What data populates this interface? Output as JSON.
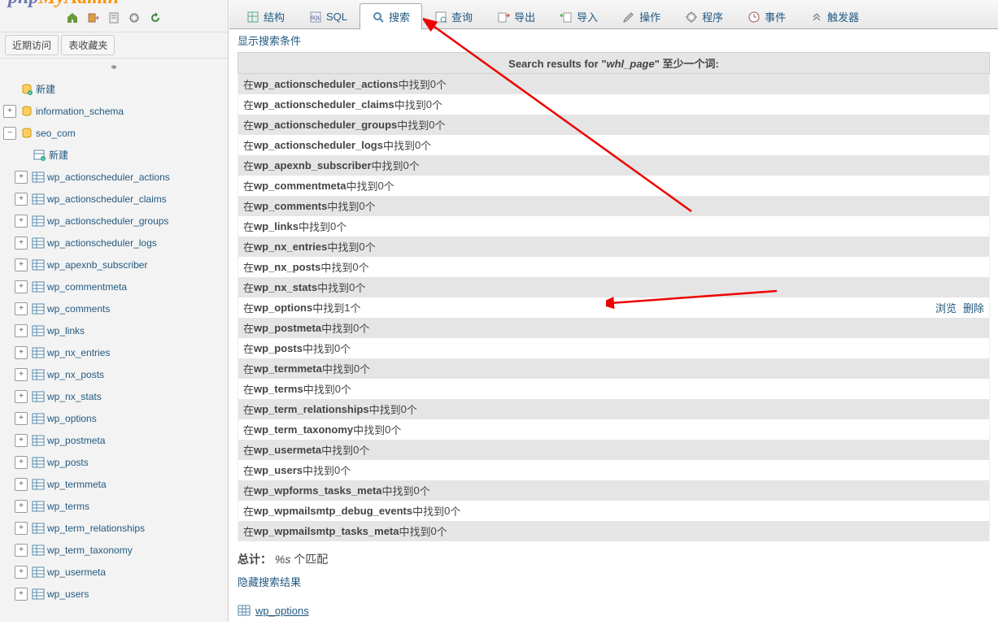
{
  "logo_fragment": "phpMyAdmin",
  "toolbar_icons": [
    "home-icon",
    "logout-icon",
    "docs-icon",
    "settings-icon",
    "reload-icon"
  ],
  "recent": {
    "recent_label": "近期访问",
    "favorites_label": "表收藏夹"
  },
  "sidebar": {
    "new_label": "新建",
    "dbs": [
      {
        "name": "information_schema",
        "expanded": false
      },
      {
        "name": "seo_com",
        "expanded": true,
        "new_label": "新建",
        "tables": [
          "wp_actionscheduler_actions",
          "wp_actionscheduler_claims",
          "wp_actionscheduler_groups",
          "wp_actionscheduler_logs",
          "wp_apexnb_subscriber",
          "wp_commentmeta",
          "wp_comments",
          "wp_links",
          "wp_nx_entries",
          "wp_nx_posts",
          "wp_nx_stats",
          "wp_options",
          "wp_postmeta",
          "wp_posts",
          "wp_termmeta",
          "wp_terms",
          "wp_term_relationships",
          "wp_term_taxonomy",
          "wp_usermeta",
          "wp_users"
        ]
      }
    ]
  },
  "tabs": [
    {
      "key": "structure",
      "label": "结构"
    },
    {
      "key": "sql",
      "label": "SQL"
    },
    {
      "key": "search",
      "label": "搜索",
      "active": true
    },
    {
      "key": "query",
      "label": "查询"
    },
    {
      "key": "export",
      "label": "导出"
    },
    {
      "key": "import",
      "label": "导入"
    },
    {
      "key": "operations",
      "label": "操作"
    },
    {
      "key": "routines",
      "label": "程序"
    },
    {
      "key": "events",
      "label": "事件"
    },
    {
      "key": "triggers",
      "label": "触发器"
    }
  ],
  "search": {
    "show_criteria": "显示搜索条件",
    "heading_prefix": "Search results for \"",
    "heading_term": "whl_page",
    "heading_suffix": "\" 至少一个词:",
    "row_prefix": "在 ",
    "row_mid": " 中找到 ",
    "row_suffix": " 个",
    "results": [
      {
        "table": "wp_actionscheduler_actions",
        "count": 0
      },
      {
        "table": "wp_actionscheduler_claims",
        "count": 0
      },
      {
        "table": "wp_actionscheduler_groups",
        "count": 0
      },
      {
        "table": "wp_actionscheduler_logs",
        "count": 0
      },
      {
        "table": "wp_apexnb_subscriber",
        "count": 0
      },
      {
        "table": "wp_commentmeta",
        "count": 0
      },
      {
        "table": "wp_comments",
        "count": 0
      },
      {
        "table": "wp_links",
        "count": 0
      },
      {
        "table": "wp_nx_entries",
        "count": 0
      },
      {
        "table": "wp_nx_posts",
        "count": 0
      },
      {
        "table": "wp_nx_stats",
        "count": 0
      },
      {
        "table": "wp_options",
        "count": 1,
        "browse": "浏览",
        "delete": "删除"
      },
      {
        "table": "wp_postmeta",
        "count": 0
      },
      {
        "table": "wp_posts",
        "count": 0
      },
      {
        "table": "wp_termmeta",
        "count": 0
      },
      {
        "table": "wp_terms",
        "count": 0
      },
      {
        "table": "wp_term_relationships",
        "count": 0
      },
      {
        "table": "wp_term_taxonomy",
        "count": 0
      },
      {
        "table": "wp_usermeta",
        "count": 0
      },
      {
        "table": "wp_users",
        "count": 0
      },
      {
        "table": "wp_wpforms_tasks_meta",
        "count": 0
      },
      {
        "table": "wp_wpmailsmtp_debug_events",
        "count": 0
      },
      {
        "table": "wp_wpmailsmtp_tasks_meta",
        "count": 0
      }
    ],
    "total_label": "总计：",
    "total_value": "%s",
    "total_suffix": " 个匹配",
    "hide_label": "隐藏搜索结果",
    "footer_table": "wp_options"
  }
}
